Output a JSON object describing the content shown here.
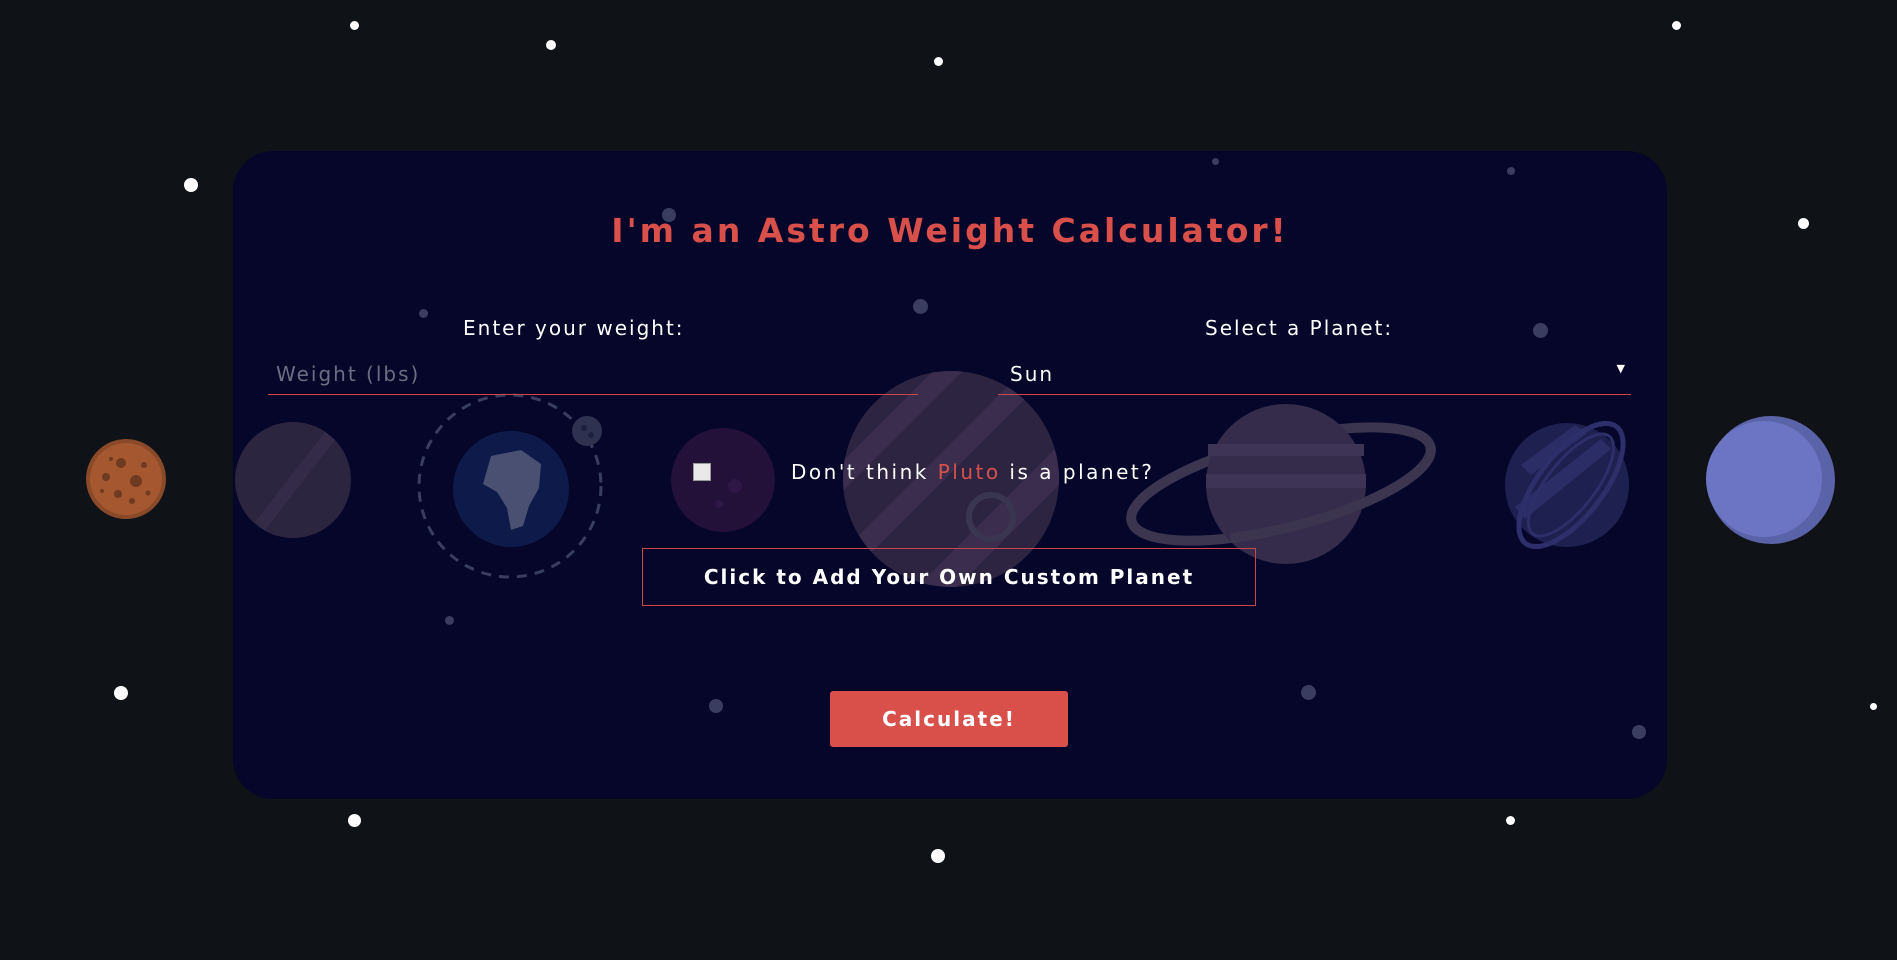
{
  "colors": {
    "background": "#0f1216",
    "card": "#05062a",
    "accent": "#d9504b",
    "text": "#ffffff"
  },
  "title": "I'm an Astro Weight Calculator!",
  "weight": {
    "label": "Enter your weight:",
    "placeholder": "Weight (lbs)",
    "value": ""
  },
  "planet": {
    "label": "Select a Planet:",
    "selected": "Sun"
  },
  "pluto": {
    "checked": false,
    "text_before": "Don't think ",
    "highlight": "Pluto",
    "text_after": " is a planet?"
  },
  "custom_planet_button": "Click to Add Your Own Custom Planet",
  "calculate_button": "Calculate!",
  "icons": [
    "mercury-icon",
    "venus-icon",
    "earth-icon",
    "moon-icon",
    "mars-icon",
    "jupiter-icon",
    "saturn-icon",
    "uranus-icon",
    "neptune-icon",
    "pluto-icon"
  ]
}
